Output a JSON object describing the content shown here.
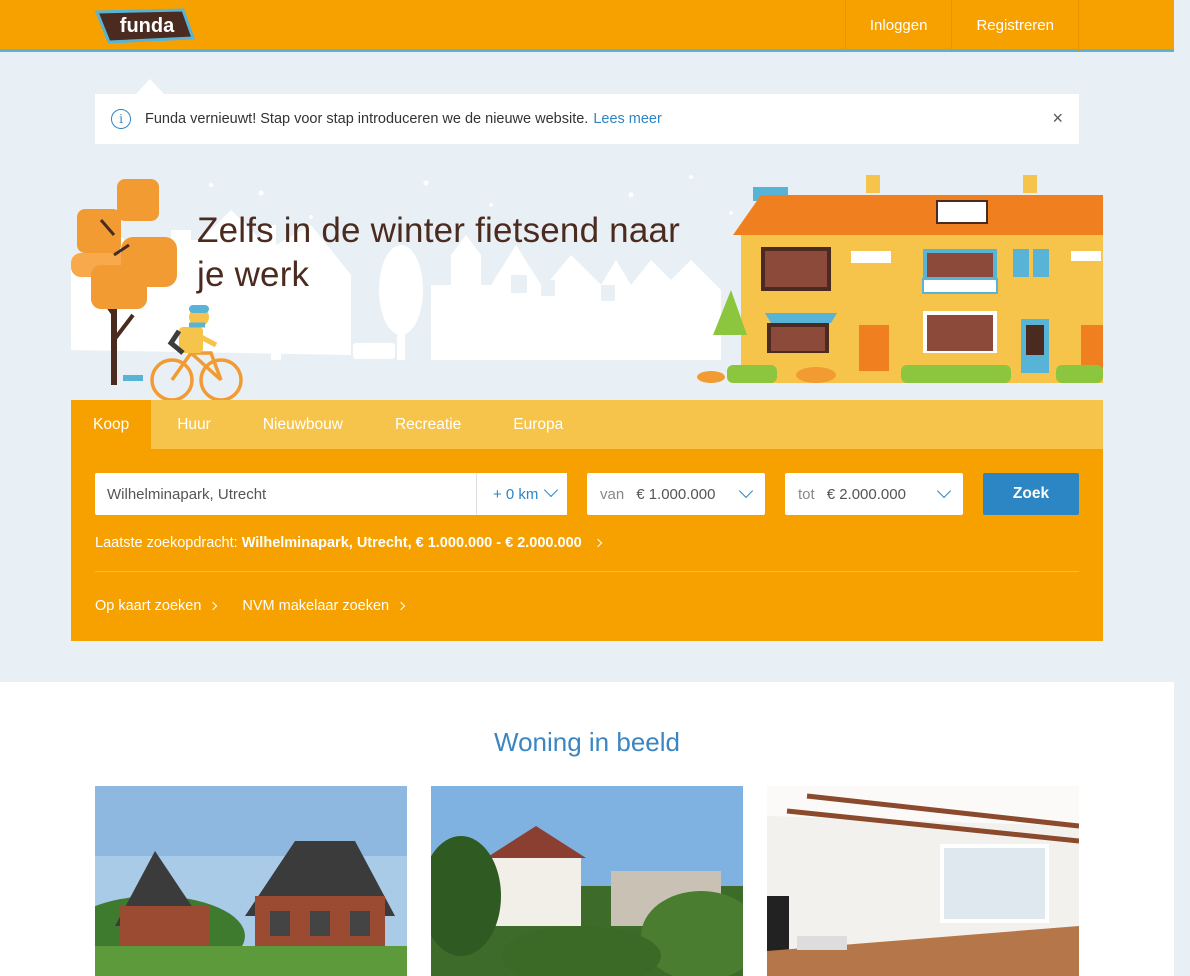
{
  "header": {
    "logo_text": "funda",
    "nav": [
      "Inloggen",
      "Registreren"
    ]
  },
  "notice": {
    "text": "Funda vernieuwt! Stap voor stap introduceren we de nieuwe website.",
    "link": "Lees meer",
    "close": "×",
    "info": "i"
  },
  "hero": {
    "title": "Zelfs in de winter fietsend naar je werk"
  },
  "search": {
    "tabs": [
      "Koop",
      "Huur",
      "Nieuwbouw",
      "Recreatie",
      "Europa"
    ],
    "location_value": "Wilhelminapark, Utrecht",
    "radius": "+ 0 km",
    "from_label": "van",
    "from_value": "€ 1.000.000",
    "to_label": "tot",
    "to_value": "€ 2.000.000",
    "button": "Zoek",
    "last_label": "Laatste zoekopdracht:",
    "last_value": "Wilhelminapark, Utrecht, € 1.000.000 - € 2.000.000",
    "links": [
      "Op kaart zoeken",
      "NVM makelaar zoeken"
    ]
  },
  "section": {
    "title": "Woning in beeld"
  },
  "colors": {
    "brand_orange": "#f7a100",
    "tab_bar": "#f7c44b",
    "accent_blue": "#2d86c4",
    "background": "#e9f0f5"
  }
}
